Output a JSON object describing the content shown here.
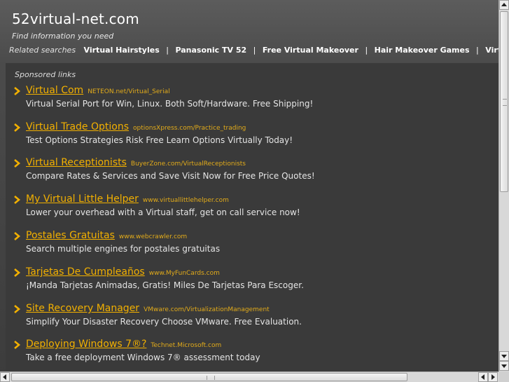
{
  "header": {
    "site_title": "52virtual-net.com",
    "tagline": "Find information you need",
    "related_label": "Related searches",
    "related_links": [
      "Virtual Hairstyles",
      "Panasonic TV 52",
      "Free Virtual Makeover",
      "Hair Makeover Games",
      "Virtual Net Au"
    ],
    "separator": "|"
  },
  "panel": {
    "sponsored_label": "Sponsored links",
    "ads": [
      {
        "title": "Virtual Com",
        "url": "NETEON.net/Virtual_Serial",
        "desc": "Virtual Serial Port for Win, Linux. Both Soft/Hardware. Free Shipping!"
      },
      {
        "title": "Virtual Trade Options",
        "url": "optionsXpress.com/Practice_trading",
        "desc": "Test Options Strategies Risk Free Learn Options Virtually Today!"
      },
      {
        "title": "Virtual Receptionists",
        "url": "BuyerZone.com/VirtualReceptionists",
        "desc": "Compare Rates & Services and Save Visit Now for Free Price Quotes!"
      },
      {
        "title": "My Virtual Little Helper",
        "url": "www.virtuallittlehelper.com",
        "desc": "Lower your overhead with a Virtual staff, get on call service now!"
      },
      {
        "title": "Postales Gratuitas",
        "url": "www.webcrawler.com",
        "desc": "Search multiple engines for postales gratuitas"
      },
      {
        "title": "Tarjetas De Cumpleaños",
        "url": "www.MyFunCards.com",
        "desc": "¡Manda Tarjetas Animadas, Gratis! Miles De Tarjetas Para Escoger."
      },
      {
        "title": "Site Recovery Manager",
        "url": "VMware.com/VirtualizationManagement",
        "desc": "Simplify Your Disaster Recovery Choose VMware. Free Evaluation."
      },
      {
        "title": "Deploying Windows 7®?",
        "url": "Technet.Microsoft.com",
        "desc": "Take a free deployment Windows 7® assessment today"
      }
    ]
  },
  "colors": {
    "ad_title": "#f2b000",
    "chevron": "#f2b000",
    "background": "#4a4a4a"
  },
  "icons": {
    "ad_bullet": "chevron-right-icon",
    "scroll_up": "arrow-up-icon",
    "scroll_down": "arrow-down-icon",
    "scroll_left": "arrow-left-icon",
    "scroll_right": "arrow-right-icon"
  }
}
